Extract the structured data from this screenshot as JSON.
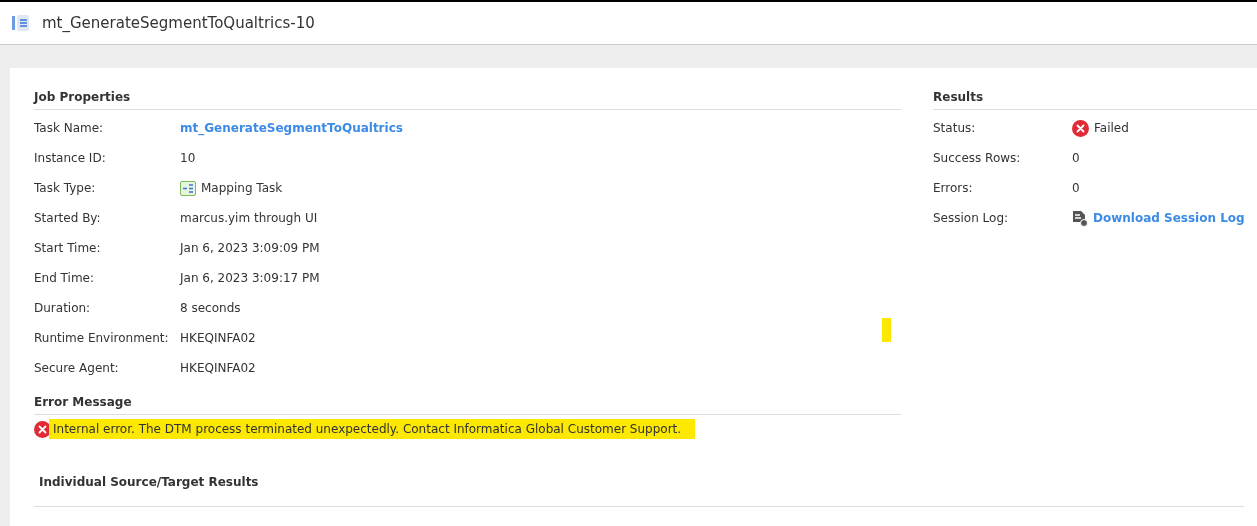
{
  "header": {
    "title": "mt_GenerateSegmentToQualtrics-10"
  },
  "job_properties": {
    "title": "Job Properties",
    "rows": [
      {
        "label": "Task Name:",
        "value": "mt_GenerateSegmentToQualtrics",
        "kind": "link"
      },
      {
        "label": "Instance ID:",
        "value": "10",
        "kind": "text"
      },
      {
        "label": "Task Type:",
        "value": "Mapping Task",
        "kind": "task-type"
      },
      {
        "label": "Started By:",
        "value": "marcus.yim through UI",
        "kind": "text"
      },
      {
        "label": "Start Time:",
        "value": "Jan 6, 2023 3:09:09 PM",
        "kind": "text"
      },
      {
        "label": "End Time:",
        "value": "Jan 6, 2023 3:09:17 PM",
        "kind": "text"
      },
      {
        "label": "Duration:",
        "value": "8 seconds",
        "kind": "text"
      },
      {
        "label": "Runtime Environment:",
        "value": "HKEQINFA02",
        "kind": "text"
      },
      {
        "label": "Secure Agent:",
        "value": "HKEQINFA02",
        "kind": "text"
      }
    ]
  },
  "results": {
    "title": "Results",
    "rows": [
      {
        "label": "Status:",
        "value": "Failed",
        "kind": "status"
      },
      {
        "label": "Success Rows:",
        "value": "0",
        "kind": "text"
      },
      {
        "label": "Errors:",
        "value": "0",
        "kind": "text"
      },
      {
        "label": "Session Log:",
        "value": "Download Session Log",
        "kind": "download"
      }
    ]
  },
  "error_message": {
    "title": "Error Message",
    "text": "Internal error. The DTM process terminated unexpectedly. Contact Informatica Global Customer Support.",
    "highlighted": true
  },
  "individual_results": {
    "title": "Individual Source/Target Results"
  }
}
